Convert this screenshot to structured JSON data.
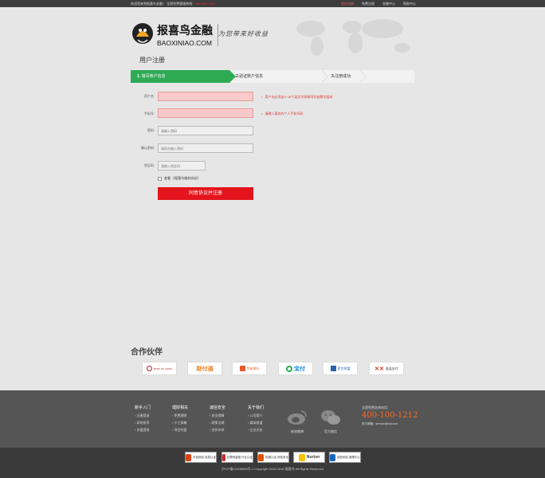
{
  "topbar": {
    "welcome": "欢迎您来到报喜鸟金融！ 全国免费客服热线：",
    "hotline": "400-100-1212",
    "nav": [
      "会员注册",
      "免费注册",
      "金融中心",
      "帮助中心"
    ]
  },
  "header": {
    "brand_cn": "报喜鸟金融",
    "brand_en": "BAOXINIAO.COM",
    "slogan": "为您带来好收益"
  },
  "page_title": "用户注册",
  "steps": [
    {
      "num": "1.",
      "label": "填写账户信息"
    },
    {
      "num": "2.",
      "label": "验证账户信息"
    },
    {
      "num": "3.",
      "label": "注册成功"
    }
  ],
  "form": {
    "username_label": "用户名:",
    "username_placeholder": "",
    "username_hint": "用户名必须由3~18个英文字母和阿拉伯数字组成",
    "phone_label": "手机号:",
    "phone_placeholder": "",
    "phone_hint": "请输入真实的个人手机号码",
    "password_label": "密码:",
    "password_placeholder": "请输入密码",
    "confirm_label": "确认密码:",
    "confirm_placeholder": "请再次输入密码",
    "captcha_label": "验证码:",
    "captcha_placeholder": "请输入验证码",
    "agree_text": "查看 《报喜鸟服务协议》",
    "submit_label": "同意协议并注册"
  },
  "partners": {
    "title": "合作伙伴",
    "items": [
      {
        "name": "BANK OF CHINA",
        "color": "#b81c22"
      },
      {
        "name": "财付通",
        "color": "#f07d1a"
      },
      {
        "name": "华安银行",
        "color": "#e9592a"
      },
      {
        "name": "宝付",
        "color": "#1a8de0"
      },
      {
        "name": "民生财富",
        "color": "#2a64a8"
      },
      {
        "name": "连连支付",
        "color": "#e4341d"
      }
    ]
  },
  "footer": {
    "columns": [
      {
        "title": "新手入门",
        "items": [
          "注册登录",
          "如何投资",
          "充值提现"
        ]
      },
      {
        "title": "理财相关",
        "items": [
          "免费理财",
          "小工具箱",
          "项目托管"
        ]
      },
      {
        "title": "诚信安全",
        "items": [
          "安全保障",
          "政策法规",
          "合作伙伴"
        ]
      },
      {
        "title": "关于我们",
        "items": [
          "公司简介",
          "媒体报道",
          "企业文化"
        ]
      }
    ],
    "weibo_label": "新浪微博",
    "wechat_label": "官方微信",
    "hotline_label": "全国免费咨询电话：",
    "hotline": "400-100-1212",
    "email": "官方邮箱：service@bxjr.com"
  },
  "badges": [
    {
      "name": "可信网站 信息认证",
      "color": "#d84315"
    },
    {
      "name": "互联网金融 行业认证",
      "color": "#c62828"
    },
    {
      "name": "权威认证 网站安全",
      "color": "#e65100"
    },
    {
      "name": "Norton",
      "color": "#f9c400"
    },
    {
      "name": "诚信网站 管理中心",
      "color": "#1565c0"
    }
  ],
  "copyright": "沪ICP备12008998号-1    Copyright 2015-2016 报喜鸟 All Rights Reserved"
}
